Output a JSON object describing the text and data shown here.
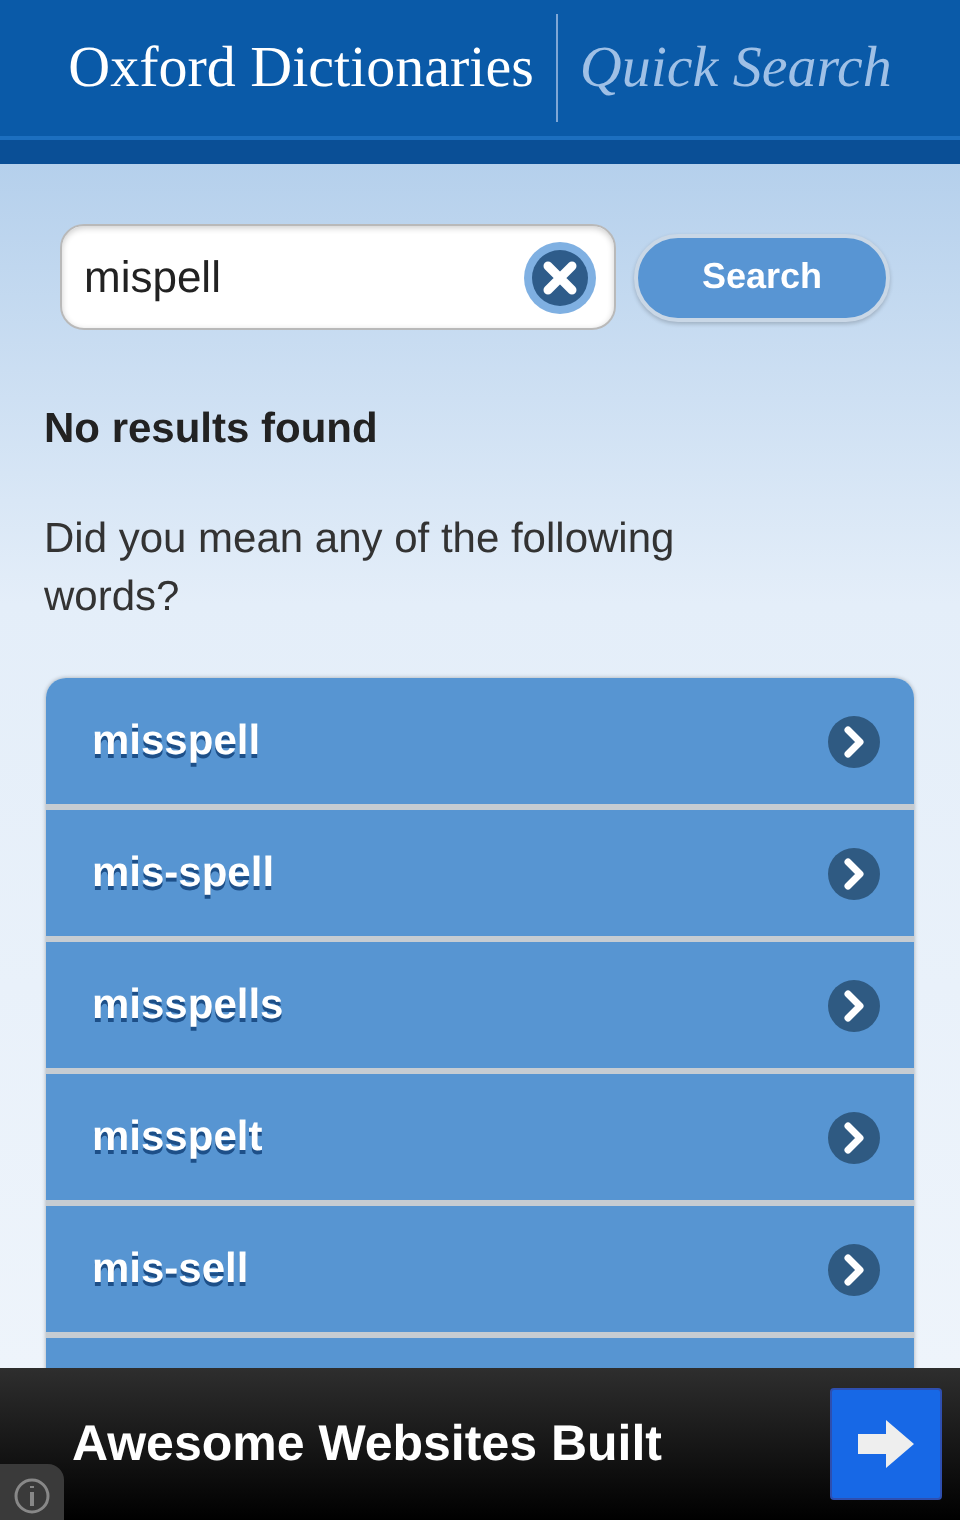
{
  "header": {
    "title": "Oxford Dictionaries",
    "subtitle": "Quick Search"
  },
  "search": {
    "value": "mispell",
    "button": "Search"
  },
  "message": "No results found",
  "prompt": "Did you mean any of the following words?",
  "suggestions": [
    {
      "word": "misspell"
    },
    {
      "word": "mis-spell"
    },
    {
      "word": "misspells"
    },
    {
      "word": "misspelt"
    },
    {
      "word": "mis-sell"
    }
  ],
  "ad": {
    "text": "Awesome Websites Built"
  }
}
